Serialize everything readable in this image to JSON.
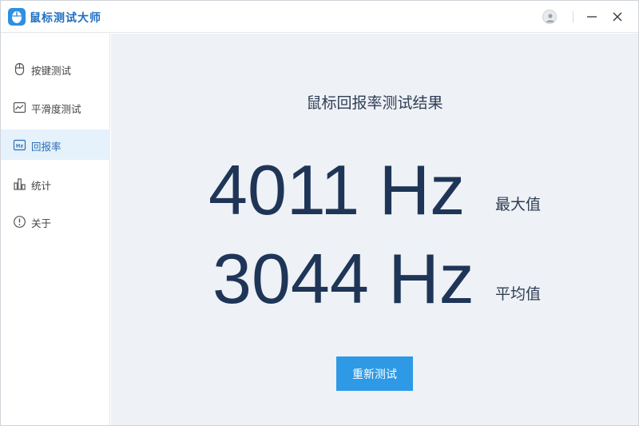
{
  "app": {
    "title": "鼠标测试大师"
  },
  "sidebar": {
    "items": [
      {
        "label": "按键测试",
        "icon": "mouse-icon",
        "active": false
      },
      {
        "label": "平滑度测试",
        "icon": "line-chart-icon",
        "active": false
      },
      {
        "label": "回报率",
        "icon": "hz-icon",
        "active": true
      },
      {
        "label": "统计",
        "icon": "bar-chart-icon",
        "active": false
      },
      {
        "label": "关于",
        "icon": "info-icon",
        "active": false
      }
    ]
  },
  "main": {
    "title": "鼠标回报率测试结果",
    "max": {
      "value": "4011 Hz",
      "label": "最大值"
    },
    "avg": {
      "value": "3044 Hz",
      "label": "平均值"
    },
    "retest_label": "重新测试"
  },
  "colors": {
    "accent": "#2e9ae6",
    "active_bg": "#e5f1fb",
    "value_text": "#1e3557",
    "main_bg": "#eef1f5"
  }
}
